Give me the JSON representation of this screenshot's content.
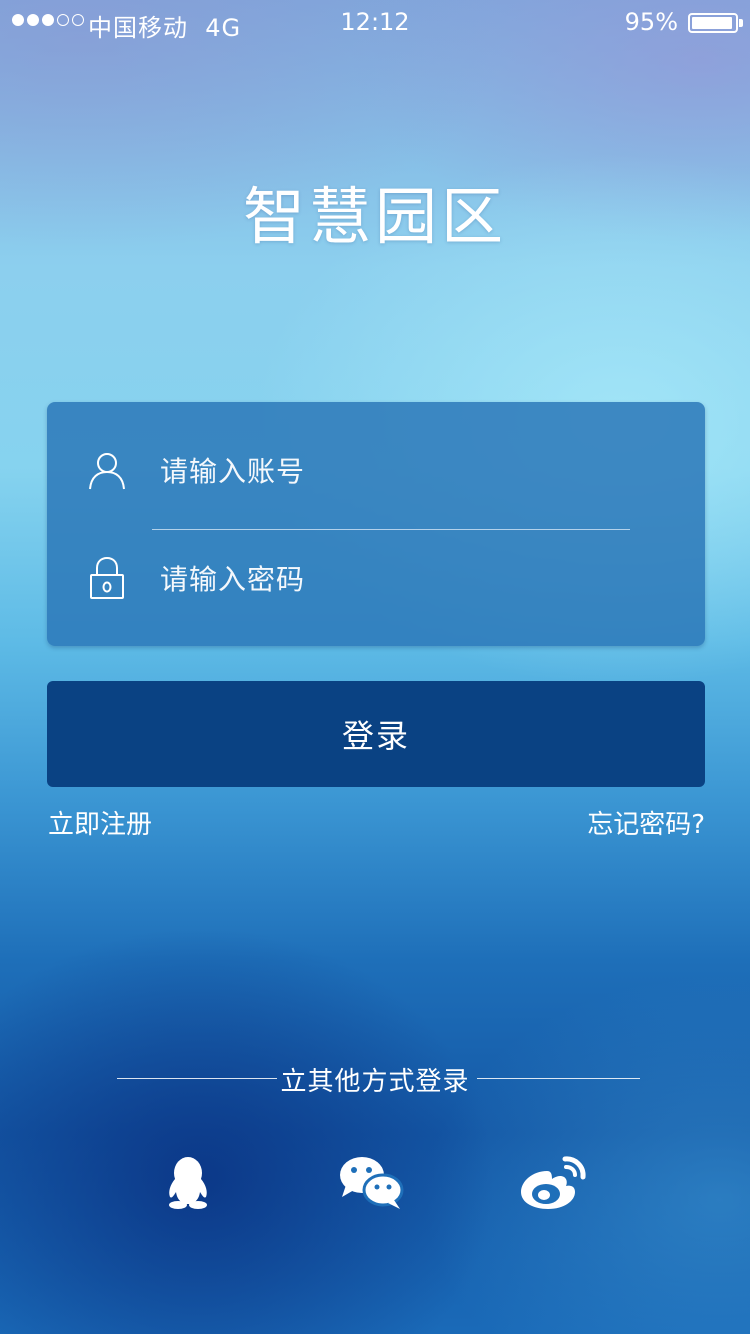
{
  "status_bar": {
    "signal_bars": 3,
    "signal_total": 5,
    "carrier": "中国移动",
    "network": "4G",
    "time": "12:12",
    "battery_percent": "95%",
    "battery_level": 0.95
  },
  "app": {
    "title": "智慧园区"
  },
  "login_form": {
    "username_placeholder": "请输入账号",
    "username_icon": "user-icon",
    "password_placeholder": "请输入密码",
    "password_icon": "lock-icon"
  },
  "actions": {
    "login_label": "登录",
    "register_label": "立即注册",
    "forgot_label": "忘记密码?"
  },
  "other_login": {
    "label": "立其他方式登录",
    "providers": [
      {
        "name": "qq-icon"
      },
      {
        "name": "wechat-icon"
      },
      {
        "name": "weibo-icon"
      }
    ]
  },
  "colors": {
    "login_button": "#0a4283",
    "card": "#2c78b9"
  }
}
